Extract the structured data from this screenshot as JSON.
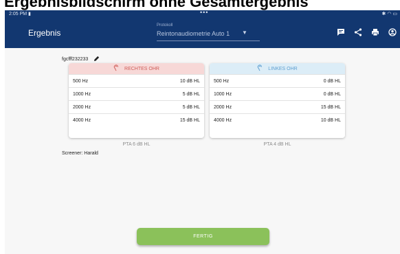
{
  "document_title": "Ergebnisbildschirm ohne Gesamtergebnis",
  "status_bar": {
    "time": "2:05 PM",
    "indicator": "▮",
    "dots": "•••",
    "system_icons": "✱ ◠ ▭"
  },
  "appbar": {
    "title": "Ergebnis",
    "protocol_label": "Protokoll",
    "protocol_value": "Reintonaudiometrie Auto 1",
    "icons": [
      "comment-icon",
      "share-icon",
      "print-icon",
      "account-icon"
    ]
  },
  "patient": {
    "name": "fgcfff232233",
    "edit_icon": "pencil-icon"
  },
  "results": {
    "right_ear": {
      "title": "RECHTES OHR",
      "icon": "ear-icon",
      "color": "#cf5c57",
      "rows": [
        {
          "freq": "500 Hz",
          "value": "10 dB HL"
        },
        {
          "freq": "1000 Hz",
          "value": "5 dB HL"
        },
        {
          "freq": "2000 Hz",
          "value": "5 dB HL"
        },
        {
          "freq": "4000 Hz",
          "value": "15 dB HL"
        }
      ],
      "pta": "PTA 6 dB HL"
    },
    "left_ear": {
      "title": "LINKES OHR",
      "icon": "ear-icon",
      "color": "#5d9ed0",
      "rows": [
        {
          "freq": "500 Hz",
          "value": "0 dB HL"
        },
        {
          "freq": "1000 Hz",
          "value": "0 dB HL"
        },
        {
          "freq": "2000 Hz",
          "value": "15 dB HL"
        },
        {
          "freq": "4000 Hz",
          "value": "10 dB HL"
        }
      ],
      "pta": "PTA 4 dB HL"
    }
  },
  "screener": "Screener: Harald",
  "done_button": "FERTIG",
  "colors": {
    "appbar": "#123770",
    "done_button": "#8bc15a"
  }
}
